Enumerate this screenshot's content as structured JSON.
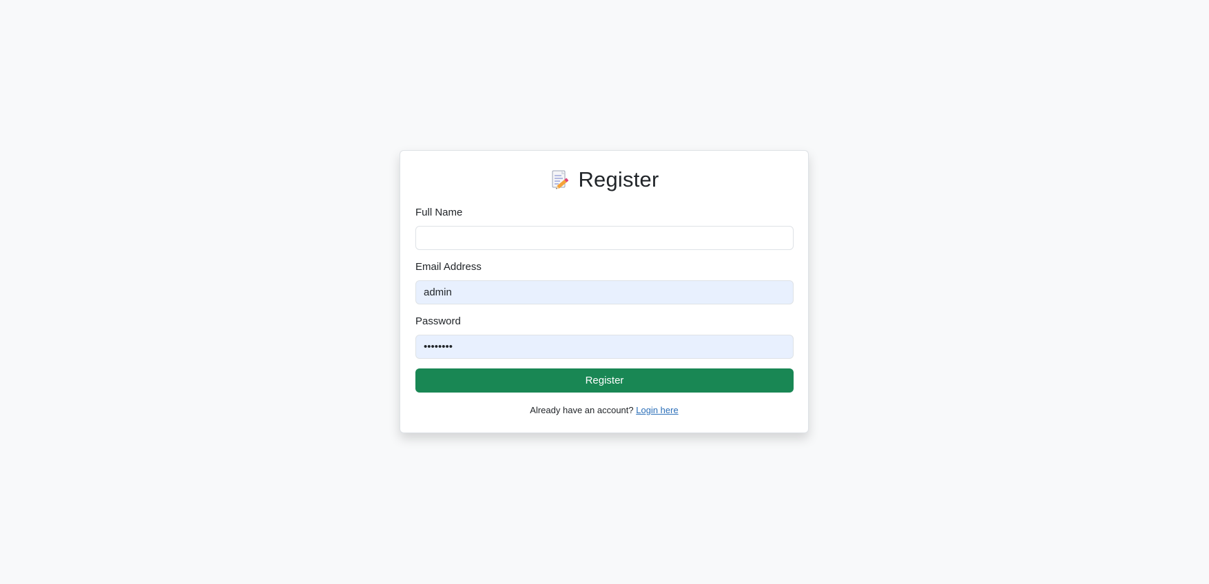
{
  "page": {
    "background": "#f8f9fa"
  },
  "card": {
    "title": "Register",
    "title_icon": "memo-icon"
  },
  "form": {
    "full_name": {
      "label": "Full Name",
      "value": "",
      "placeholder": ""
    },
    "email": {
      "label": "Email Address",
      "value": "admin",
      "placeholder": ""
    },
    "password": {
      "label": "Password",
      "value": "password",
      "placeholder": ""
    },
    "submit_label": "Register",
    "submit_color": "#198754"
  },
  "footer": {
    "prompt": "Already have an account?",
    "link_label": "Login here",
    "link_color": "#2a6eb8"
  }
}
